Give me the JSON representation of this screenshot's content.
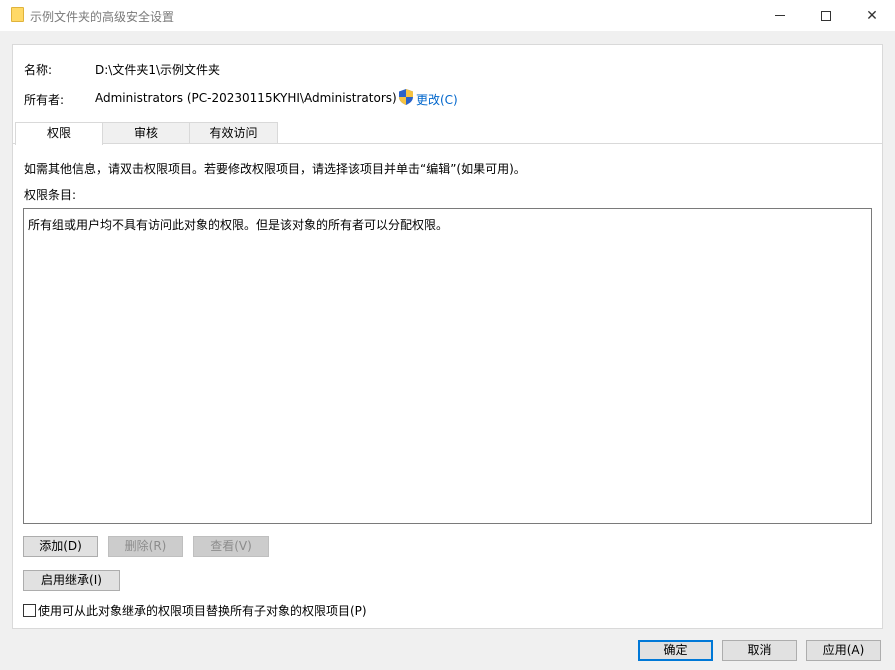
{
  "window": {
    "title": "示例文件夹的高级安全设置",
    "controls": {
      "minimize": "minimize",
      "maximize": "maximize",
      "close": "✕"
    }
  },
  "header": {
    "name_label": "名称:",
    "name_value": "D:\\文件夹1\\示例文件夹",
    "owner_label": "所有者:",
    "owner_value": "Administrators (PC-20230115KYHI\\Administrators)",
    "change_link": "更改(C)"
  },
  "tabs": [
    {
      "label": "权限",
      "active": true
    },
    {
      "label": "审核",
      "active": false
    },
    {
      "label": "有效访问",
      "active": false
    }
  ],
  "permissions": {
    "info_text": "如需其他信息，请双击权限项目。若要修改权限项目，请选择该项目并单击“编辑”(如果可用)。",
    "entries_label": "权限条目:",
    "empty_message": "所有组或用户均不具有访问此对象的权限。但是该对象的所有者可以分配权限。",
    "buttons": {
      "add": "添加(D)",
      "remove": "删除(R)",
      "view": "查看(V)",
      "enable_inheritance": "启用继承(I)"
    },
    "replace_child_checkbox": {
      "label": "使用可从此对象继承的权限项目替换所有子对象的权限项目(P)",
      "checked": false
    }
  },
  "footer": {
    "ok": "确定",
    "cancel": "取消",
    "apply": "应用(A)"
  },
  "colors": {
    "link": "#0066cc",
    "default_button_border": "#0078d7"
  }
}
